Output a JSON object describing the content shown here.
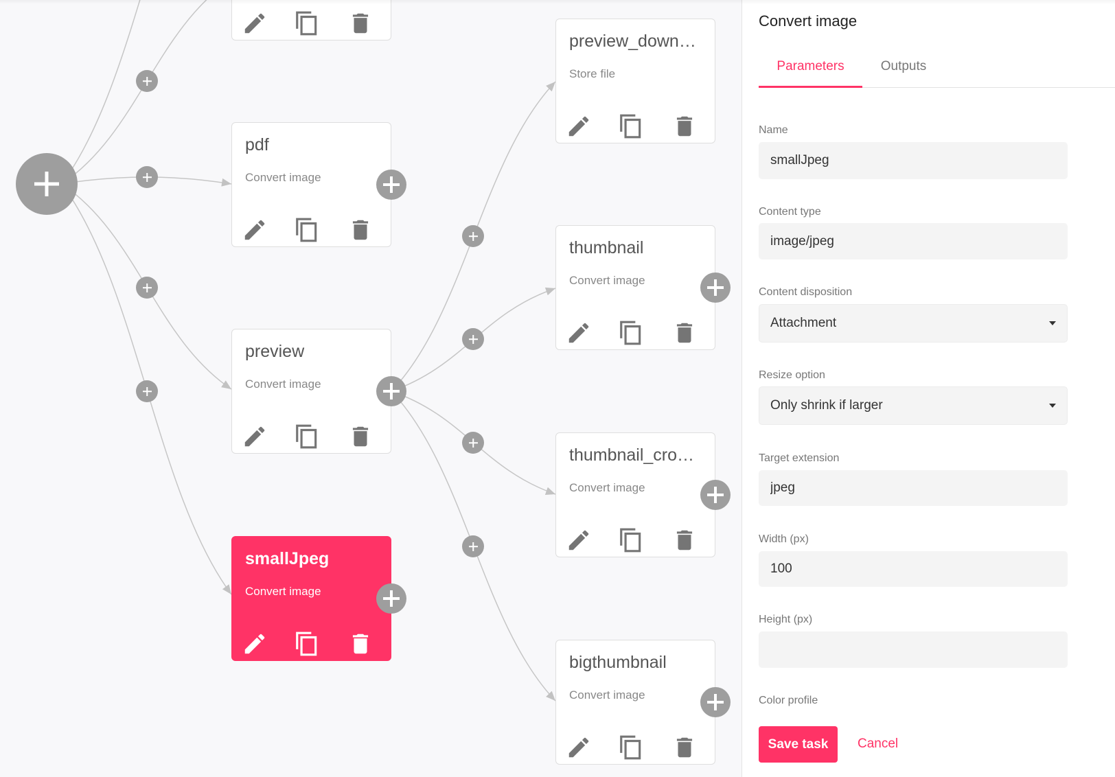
{
  "theme": {
    "accent": "#ff3366",
    "node_control_gray": "#9e9e9e",
    "canvas_background": "#f8f8fa"
  },
  "icons": {
    "add": "plus-icon",
    "edit": "pencil-icon",
    "duplicate": "copy-icon",
    "delete": "trash-icon",
    "dropdown": "caret-down-icon",
    "edge_arrow": "arrowhead-icon"
  },
  "canvas": {
    "selected_task": "smallJpeg",
    "nodes": [
      {
        "title": "pdf",
        "type": "Convert image",
        "selected": false
      },
      {
        "title": "preview",
        "type": "Convert image",
        "selected": false
      },
      {
        "title": "smallJpeg",
        "type": "Convert image",
        "selected": true
      },
      {
        "title": "preview_down…",
        "type": "Store file",
        "selected": false
      },
      {
        "title": "thumbnail",
        "type": "Convert image",
        "selected": false
      },
      {
        "title": "thumbnail_cro…",
        "type": "Convert image",
        "selected": false
      },
      {
        "title": "bigthumbnail",
        "type": "Convert image",
        "selected": false
      }
    ]
  },
  "panel": {
    "title": "Convert image",
    "tabs": [
      {
        "label": "Parameters",
        "active": true
      },
      {
        "label": "Outputs",
        "active": false
      }
    ],
    "fields": [
      {
        "label": "Name",
        "type": "text",
        "value": "smallJpeg"
      },
      {
        "label": "Content type",
        "type": "text",
        "value": "image/jpeg"
      },
      {
        "label": "Content disposition",
        "type": "select",
        "value": "Attachment"
      },
      {
        "label": "Resize option",
        "type": "select",
        "value": "Only shrink if larger"
      },
      {
        "label": "Target extension",
        "type": "text",
        "value": "jpeg"
      },
      {
        "label": "Width (px)",
        "type": "text",
        "value": "100"
      },
      {
        "label": "Height (px)",
        "type": "text",
        "value": ""
      },
      {
        "label": "Color profile"
      }
    ],
    "save_label": "Save task",
    "cancel_label": "Cancel"
  }
}
